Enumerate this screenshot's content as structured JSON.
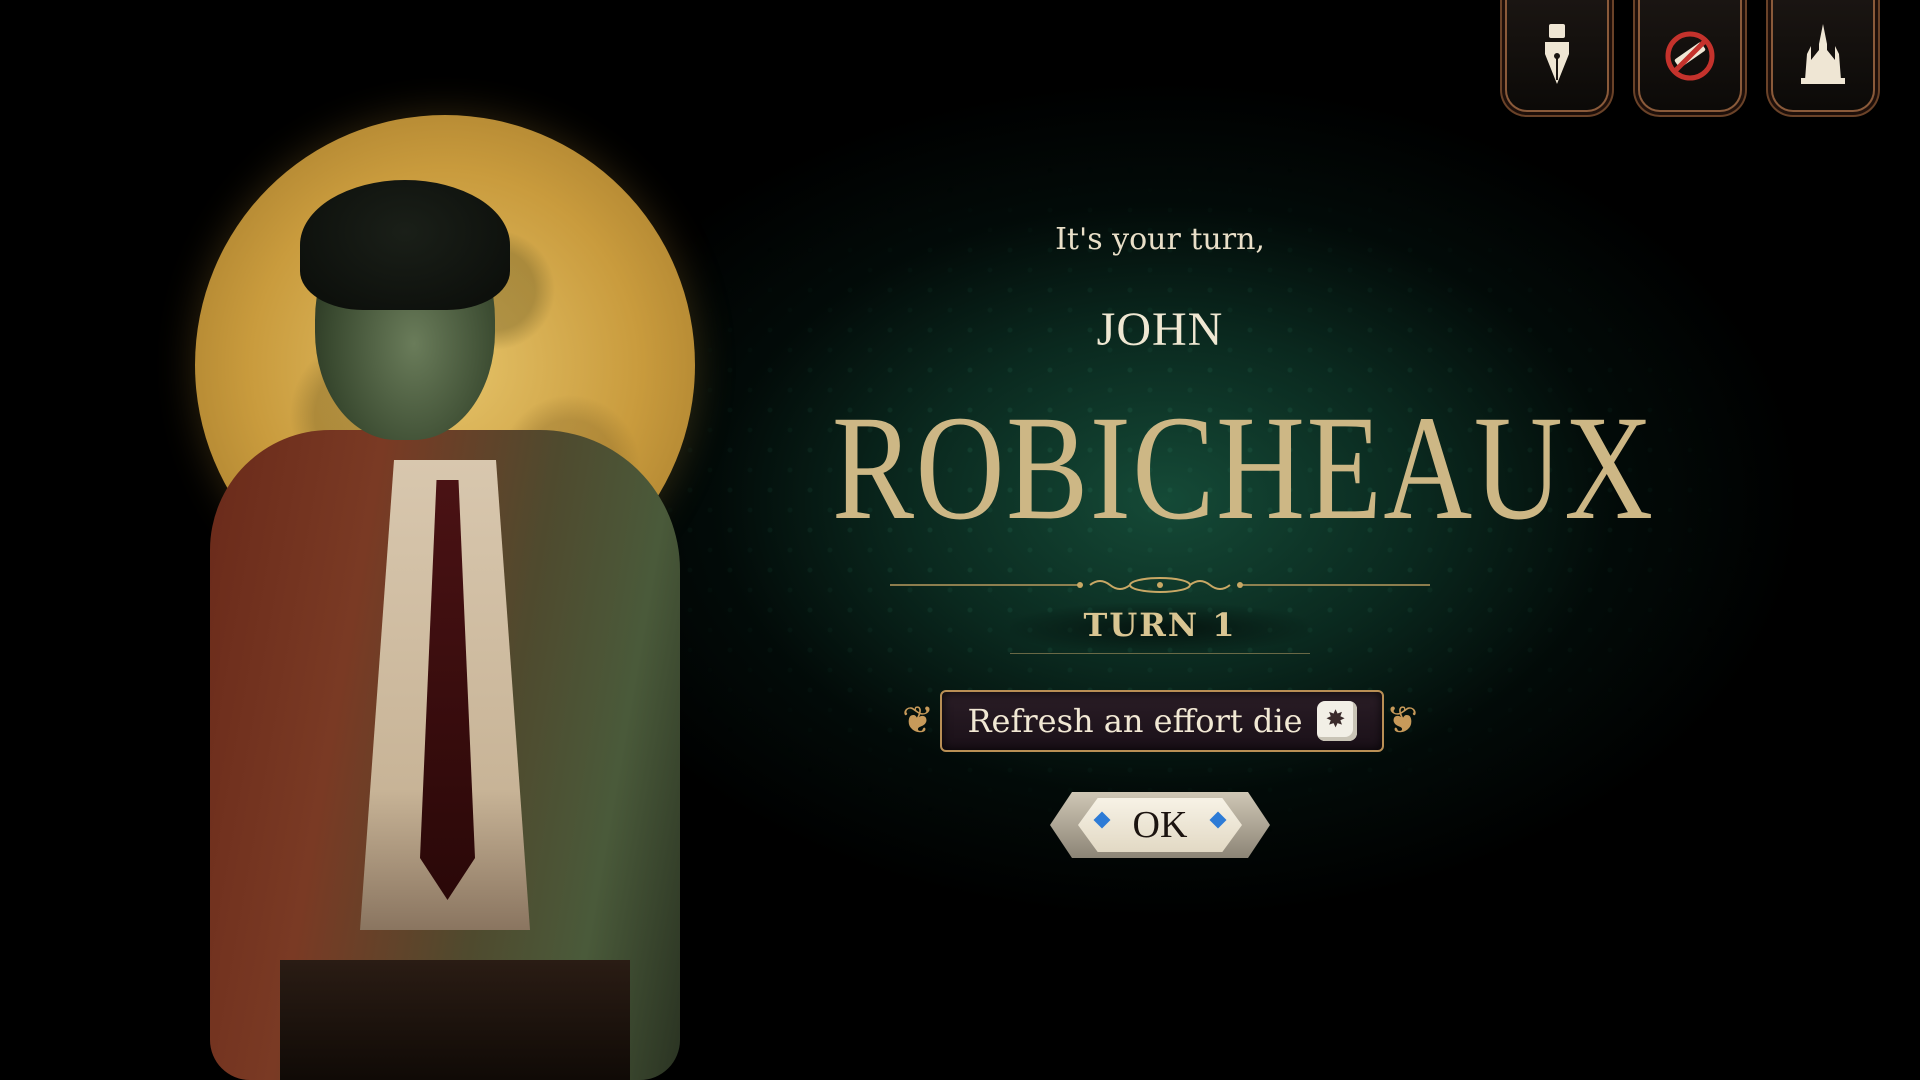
{
  "hud": {
    "icons": [
      {
        "name": "fountain-pen-icon"
      },
      {
        "name": "no-gun-icon"
      },
      {
        "name": "cathedral-icon"
      }
    ]
  },
  "turn_prompt": {
    "subtitle": "It's your turn,",
    "first_name": "JOHN",
    "last_name": "ROBICHEAUX",
    "turn_label": "TURN 1",
    "action_text": "Refresh an effort die",
    "ok_label": "OK"
  },
  "colors": {
    "gold": "#cdb785",
    "cream": "#efe7d2",
    "bg_green": "#164e3a",
    "frame_copper": "#8a5a3a",
    "gem_blue": "#2d7bd6"
  }
}
